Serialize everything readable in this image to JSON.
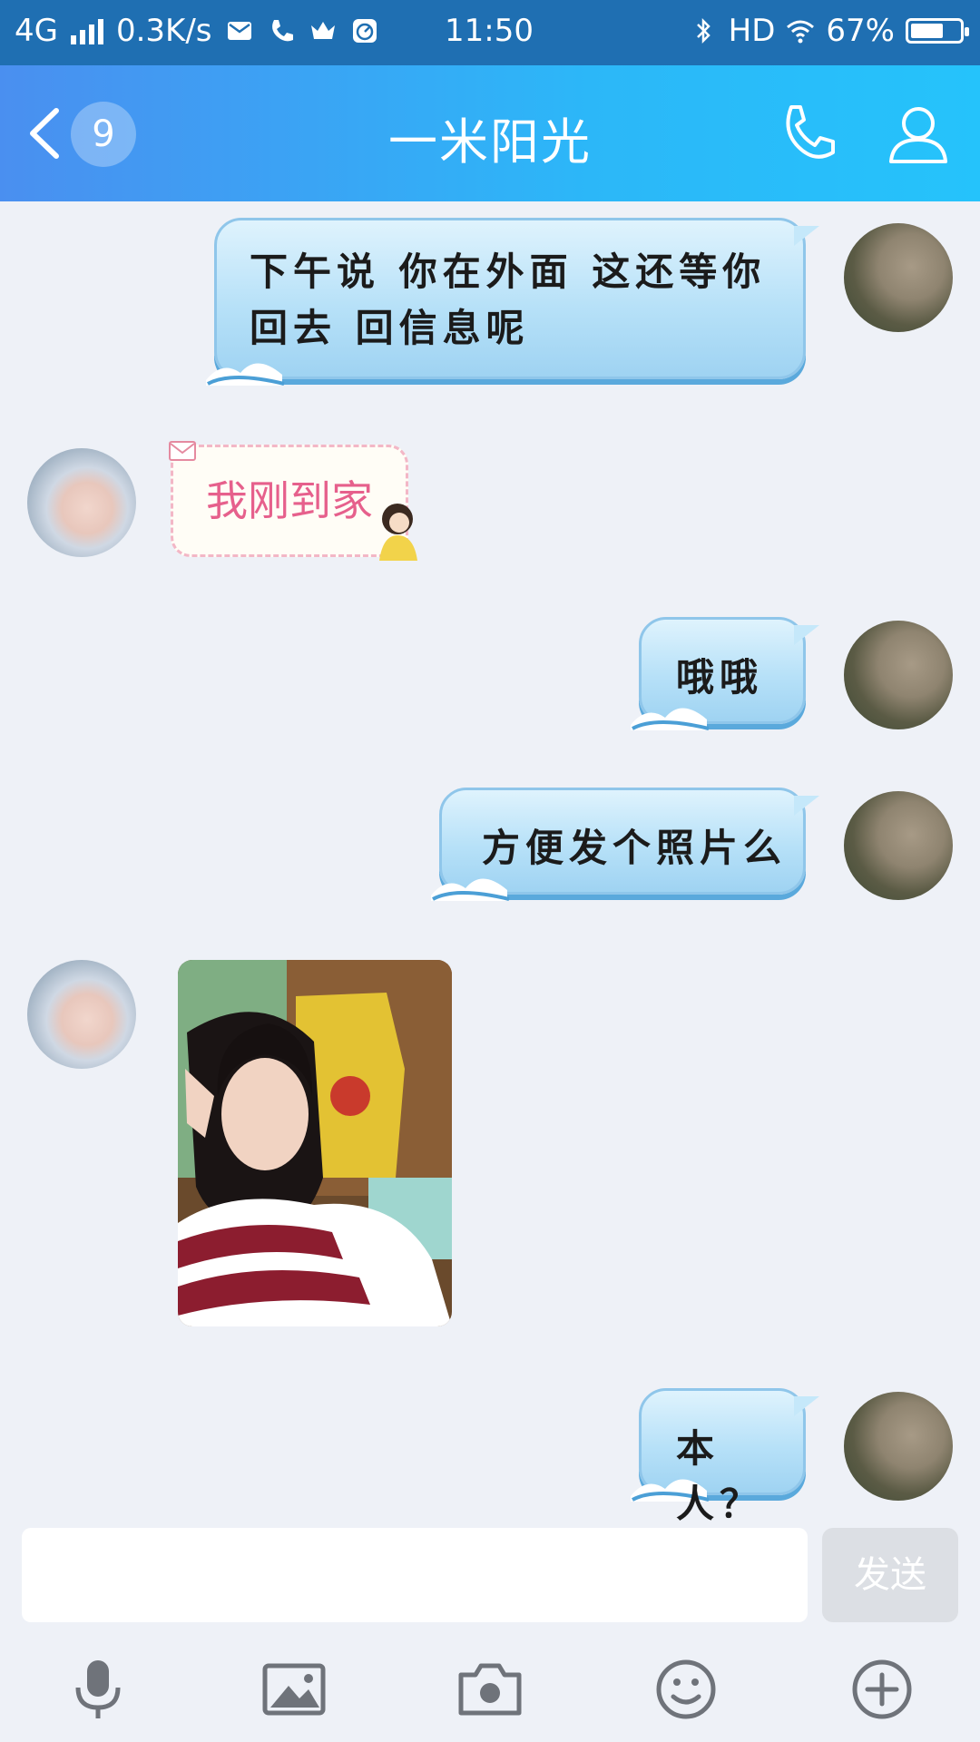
{
  "status_bar": {
    "network": "4G",
    "speed": "0.3K/s",
    "time": "11:50",
    "hd": "HD",
    "battery": "67%",
    "battery_level": 0.67
  },
  "header": {
    "unread_count": "9",
    "title": "一米阳光"
  },
  "messages": [
    {
      "side": "right",
      "type": "text",
      "lines": [
        "下午说 你在外面  这还等你",
        "回去 回信息呢"
      ]
    },
    {
      "side": "left",
      "type": "text",
      "text": "我刚到家"
    },
    {
      "side": "right",
      "type": "text",
      "text": "哦哦"
    },
    {
      "side": "right",
      "type": "text",
      "text": "方便发个照片么"
    },
    {
      "side": "left",
      "type": "image"
    },
    {
      "side": "right",
      "type": "text",
      "text": "本人？"
    }
  ],
  "input": {
    "value": "",
    "send_label": "发送"
  },
  "toolbar": [
    "microphone-icon",
    "image-icon",
    "camera-icon",
    "emoji-icon",
    "plus-icon"
  ],
  "colors": {
    "status_bar": "#1f6fb2",
    "header_start": "#4a8ff0",
    "header_end": "#25c3fb",
    "background": "#eef1f7",
    "bubble": "#b7e1f8",
    "pink_text": "#e6608c"
  }
}
